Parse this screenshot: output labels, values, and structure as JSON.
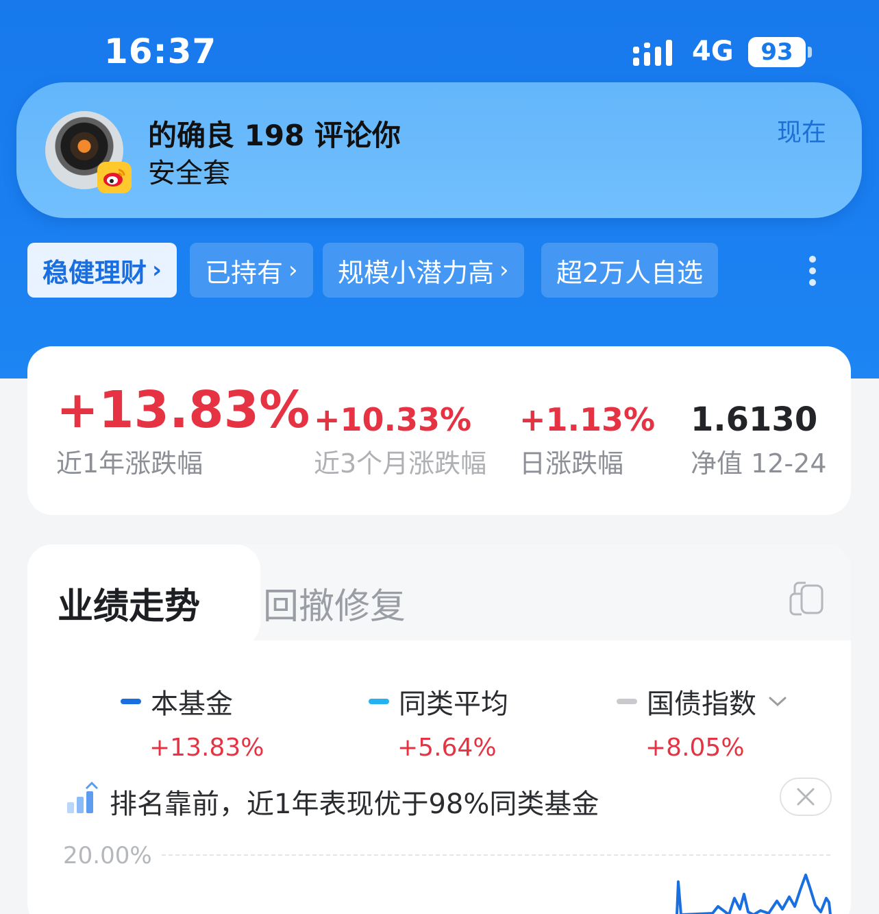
{
  "status_bar": {
    "time": "16:37",
    "network": "4G",
    "battery": "93",
    "icons": [
      "signal-icon",
      "battery-icon"
    ]
  },
  "notification": {
    "title": "的确良 198 评论你",
    "body": "安全套",
    "time": "现在",
    "app_icon": "weibo-icon"
  },
  "chips": [
    {
      "label": "稳健理财",
      "chevron": "›"
    },
    {
      "label": "已持有",
      "chevron": "›"
    },
    {
      "label": "规模小潜力高",
      "chevron": "›"
    },
    {
      "label": "超2万人自选",
      "chevron": ""
    }
  ],
  "stats": {
    "year1": {
      "value": "+13.83%",
      "label": "近1年涨跌幅"
    },
    "month3": {
      "value": "+10.33%",
      "label": "近3个月涨跌幅"
    },
    "day": {
      "value": "+1.13%",
      "label": "日涨跌幅"
    },
    "nav": {
      "value": "1.6130",
      "label": "净值 12-24"
    }
  },
  "performance": {
    "tabs": [
      "业绩走势",
      "回撤修复"
    ],
    "legend": [
      {
        "name": "本基金",
        "value": "+13.83%",
        "color": "#1a6fe0"
      },
      {
        "name": "同类平均",
        "value": "+5.64%",
        "color": "#24b3f0"
      },
      {
        "name": "国债指数",
        "value": "+8.05%",
        "color": "#c8cacd"
      }
    ],
    "legend_dropdown_icon": "chevron-down-icon",
    "rank_text": "排名靠前，近1年表现优于98%同类基金",
    "y_axis_label": "20.00%"
  },
  "colors": {
    "brand_blue": "#1779ec",
    "up_red": "#e63343"
  }
}
